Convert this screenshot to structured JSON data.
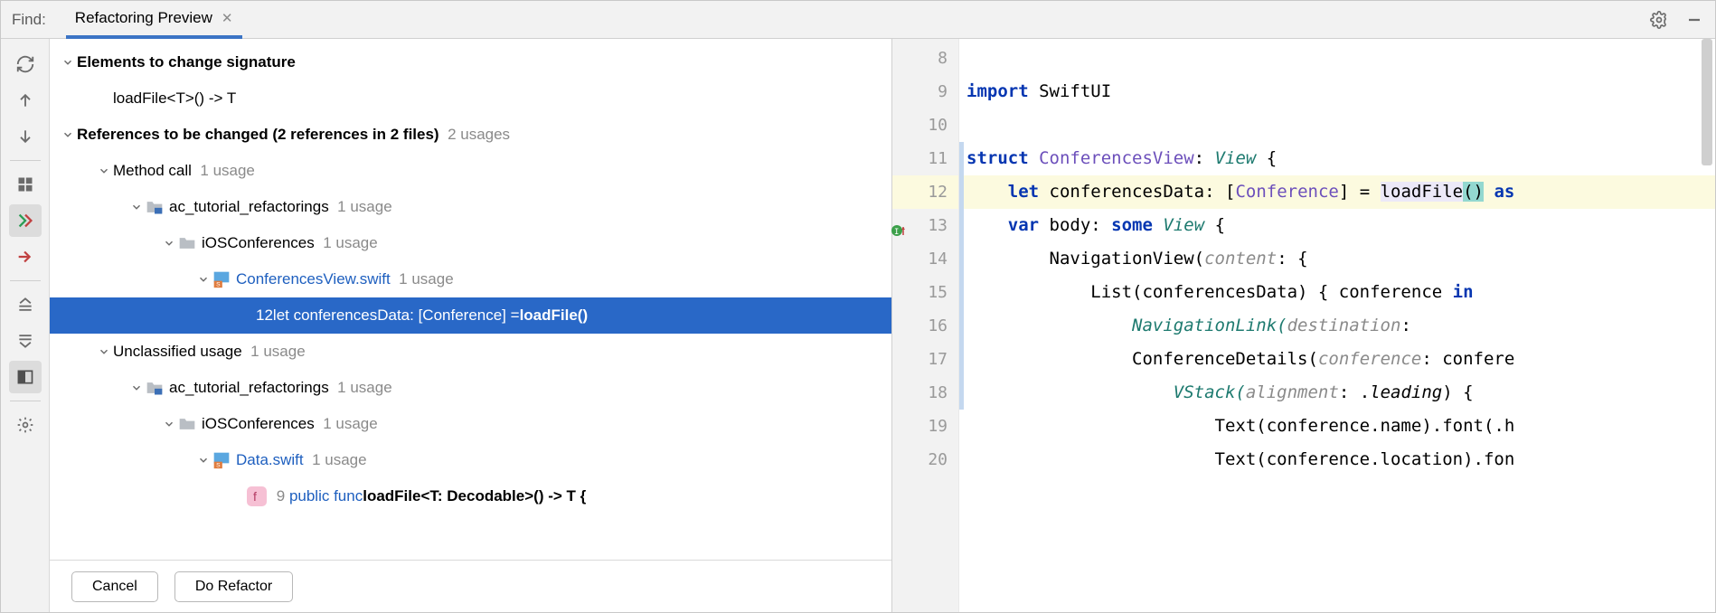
{
  "tabbar": {
    "find_label": "Find:",
    "tab_title": "Refactoring Preview"
  },
  "tree": {
    "elements_header": "Elements to change signature",
    "signature": "loadFile<T>() -> T",
    "references_header": "References to be changed  (2 references in 2 files)",
    "references_usages": "2 usages",
    "method_call": "Method call",
    "one_usage": "1 usage",
    "module": "ac_tutorial_refactorings",
    "folder": "iOSConferences",
    "file_conf": "ConferencesView.swift",
    "usage_line_prefix": "12",
    "usage_line_text": " let conferencesData: [Conference] = ",
    "usage_line_bold": "loadFile()",
    "unclassified": "Unclassified usage",
    "file_data": "Data.swift",
    "func_linenum": "9",
    "func_prefix": "public func ",
    "func_sig": "loadFile<T: Decodable>() -> T {"
  },
  "buttons": {
    "cancel": "Cancel",
    "do_refactor": "Do Refactor"
  },
  "gutter": {
    "lines": [
      "8",
      "9",
      "10",
      "11",
      "12",
      "13",
      "14",
      "15",
      "16",
      "17",
      "18",
      "19",
      "20"
    ]
  },
  "code": {
    "l8": "",
    "l9_kw": "import",
    "l9_rest": " SwiftUI",
    "l10": "",
    "l11_kw1": "struct",
    "l11_type": " ConferencesView",
    "l11_colon": ": ",
    "l11_proto": "View",
    "l11_brace": " {",
    "l12_indent": "    ",
    "l12_kw": "let",
    "l12_name": " conferencesData: [",
    "l12_type": "Conference",
    "l12_mid": "] = ",
    "l12_call": "loadFile",
    "l12_paren": "()",
    "l12_tail": " as",
    "l13_indent": "    ",
    "l13_kw": "var",
    "l13_name": " body: ",
    "l13_some": "some",
    "l13_view": " View",
    "l13_brace": " {",
    "l14": "        NavigationView(",
    "l14_param": "content",
    "l14_tail": ": {",
    "l15": "            List(conferencesData) { conference ",
    "l15_kw": "in",
    "l16": "                NavigationLink(",
    "l16_param": "destination",
    "l16_tail": ":",
    "l17": "                ConferenceDetails(",
    "l17_param": "conference",
    "l17_tail": ": confere",
    "l18": "                    VStack(",
    "l18_param": "alignment",
    "l18_mid": ": .",
    "l18_enum": "leading",
    "l18_tail": ") {",
    "l19": "                        Text(conference.name).font(.h",
    "l20": "                        Text(conference.location).fon"
  }
}
